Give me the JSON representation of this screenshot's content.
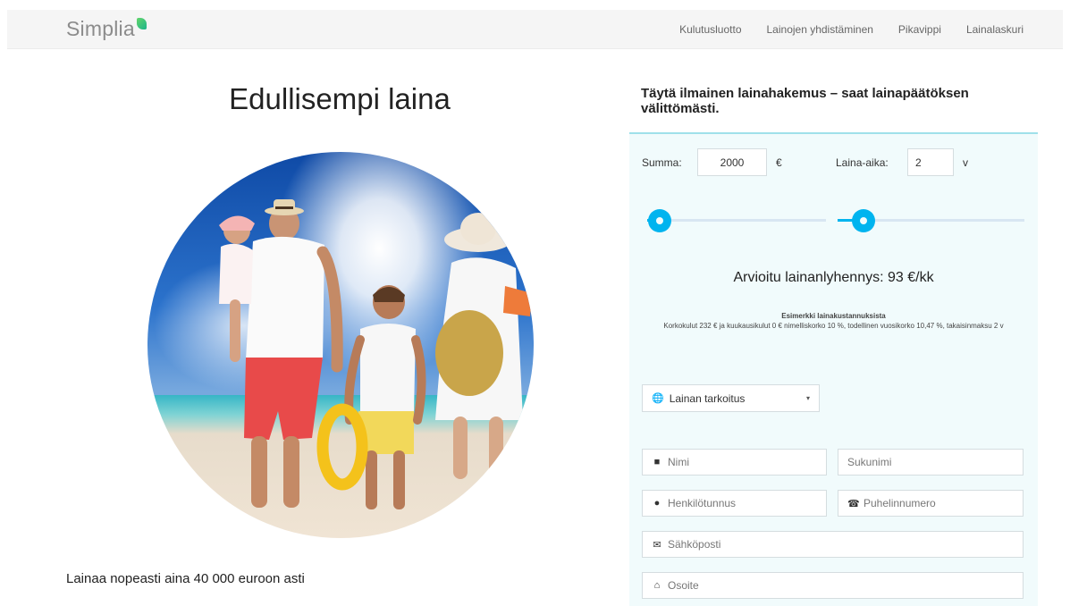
{
  "header": {
    "logo": "Simplia",
    "nav": [
      "Kulutusluotto",
      "Lainojen yhdistäminen",
      "Pikavippi",
      "Lainalaskuri"
    ]
  },
  "hero": {
    "title": "Edullisempi laina",
    "tagline": "Lainaa nopeasti aina 40 000 euroon asti"
  },
  "form": {
    "heading": "Täytä ilmainen lainahakemus – saat lainapäätöksen välittömästi.",
    "amount_label": "Summa:",
    "amount_value": "2000",
    "amount_unit": "€",
    "term_label": "Laina-aika:",
    "term_value": "2",
    "term_unit": "v",
    "amount_slider_level": 0.07,
    "term_slider_level": 0.14,
    "estimate": "Arvioitu lainanlyhennys: 93 €/kk",
    "disclaimer_title": "Esimerkki lainakustannuksista",
    "disclaimer_text": "Korkokulut 232 € ja kuukausikulut 0 € nimelliskorko 10 %, todellinen vuosikorko 10,47 %, takaisinmaksu 2 v",
    "purpose_placeholder": "Lainan tarkoitus",
    "first_name_placeholder": "Nimi",
    "last_name_placeholder": "Sukunimi",
    "ssn_placeholder": "Henkilötunnus",
    "phone_placeholder": "Puhelinnumero",
    "email_placeholder": "Sähköposti",
    "address_placeholder": "Osoite"
  },
  "colors": {
    "accent": "#00b4ef",
    "panel_bg": "#f1fbfc",
    "panel_border": "#9fe0ea"
  },
  "icons": {
    "purpose": "globe-icon",
    "first_name": "user-icon",
    "ssn": "id-icon",
    "phone": "phone-icon",
    "email": "envelope-icon",
    "address": "home-icon"
  }
}
